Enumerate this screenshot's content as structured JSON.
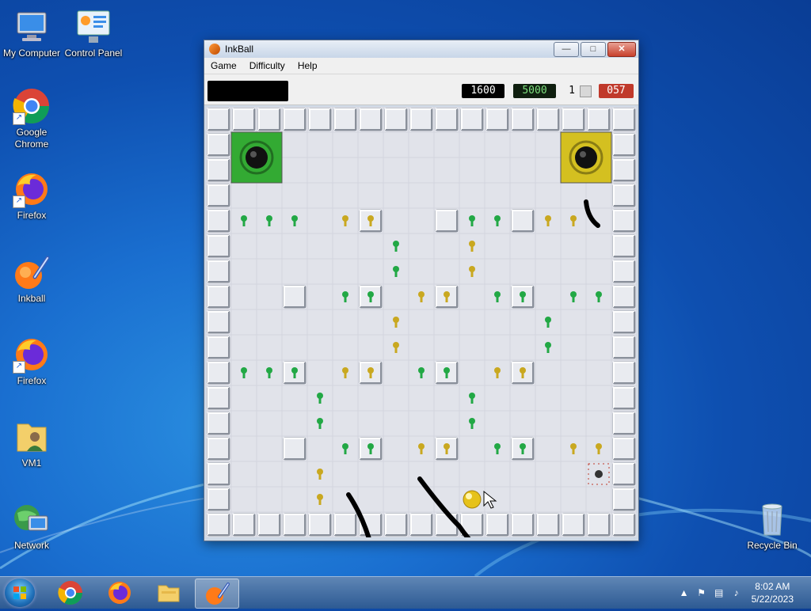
{
  "desktop": {
    "icons": [
      {
        "label": "My Computer",
        "icon": "computer-icon"
      },
      {
        "label": "Control Panel",
        "icon": "control-panel-icon"
      },
      {
        "label": "Google Chrome",
        "icon": "chrome-icon"
      },
      {
        "label": "Firefox",
        "icon": "firefox-icon"
      },
      {
        "label": "Inkball",
        "icon": "inkball-icon"
      },
      {
        "label": "Firefox",
        "icon": "firefox-icon"
      },
      {
        "label": "VM1",
        "icon": "user-folder-icon"
      },
      {
        "label": "Network",
        "icon": "network-icon"
      },
      {
        "label": "Recycle Bin",
        "icon": "recycle-bin-icon"
      }
    ]
  },
  "window": {
    "title": "InkBall",
    "controls": {
      "minimize": "—",
      "maximize": "□",
      "close": "✕"
    },
    "menu": [
      "Game",
      "Difficulty",
      "Help"
    ],
    "status": {
      "score": "1600",
      "target": "5000",
      "level": "1",
      "time": "057"
    }
  },
  "taskbar": {
    "apps": [
      "Google Chrome",
      "Firefox",
      "File Explorer",
      "InkBall"
    ],
    "clock_time": "8:02 AM",
    "clock_date": "5/22/2023"
  },
  "colors": {
    "green_goal": "#33aa33",
    "yellow_goal": "#d4c020",
    "green_pin": "#22a845",
    "yellow_pin": "#c9a820",
    "tile": "#e1e3ea",
    "ink": "#000000"
  },
  "game": {
    "grid_size": 17,
    "wall_rows": [
      "WWWWWWWWWWWWWWWWW",
      "W...............W",
      "W...............W",
      "W...............W",
      "W.....W..W..W...W",
      "W...............W",
      "W...............W",
      "W..W..W..W..W...W",
      "W...............W",
      "W...............W",
      "W..W..W..W..W...W",
      "W...............W",
      "W...............W",
      "W..W..W..W..W...W",
      "W...............W",
      "W...............W",
      "WWWWWWWWWWWWWWWWW"
    ],
    "pins": [
      [
        4,
        1,
        "g"
      ],
      [
        4,
        2,
        "g"
      ],
      [
        4,
        3,
        "g"
      ],
      [
        4,
        5,
        "y"
      ],
      [
        4,
        6,
        "y"
      ],
      [
        4,
        10,
        "g"
      ],
      [
        4,
        11,
        "g"
      ],
      [
        4,
        13,
        "y"
      ],
      [
        4,
        14,
        "y"
      ],
      [
        5,
        7,
        "g"
      ],
      [
        5,
        10,
        "y"
      ],
      [
        6,
        7,
        "g"
      ],
      [
        6,
        10,
        "y"
      ],
      [
        7,
        5,
        "g"
      ],
      [
        7,
        6,
        "g"
      ],
      [
        7,
        8,
        "y"
      ],
      [
        7,
        9,
        "y"
      ],
      [
        7,
        11,
        "g"
      ],
      [
        7,
        12,
        "g"
      ],
      [
        7,
        14,
        "g"
      ],
      [
        7,
        15,
        "g"
      ],
      [
        8,
        7,
        "y"
      ],
      [
        8,
        13,
        "g"
      ],
      [
        9,
        7,
        "y"
      ],
      [
        9,
        13,
        "g"
      ],
      [
        10,
        1,
        "g"
      ],
      [
        10,
        2,
        "g"
      ],
      [
        10,
        3,
        "g"
      ],
      [
        10,
        5,
        "y"
      ],
      [
        10,
        6,
        "y"
      ],
      [
        10,
        8,
        "g"
      ],
      [
        10,
        9,
        "g"
      ],
      [
        10,
        11,
        "y"
      ],
      [
        10,
        12,
        "y"
      ],
      [
        11,
        4,
        "g"
      ],
      [
        11,
        10,
        "g"
      ],
      [
        12,
        4,
        "g"
      ],
      [
        12,
        10,
        "g"
      ],
      [
        13,
        5,
        "g"
      ],
      [
        13,
        6,
        "g"
      ],
      [
        13,
        8,
        "y"
      ],
      [
        13,
        9,
        "y"
      ],
      [
        13,
        11,
        "g"
      ],
      [
        13,
        12,
        "g"
      ],
      [
        13,
        14,
        "y"
      ],
      [
        13,
        15,
        "y"
      ],
      [
        14,
        4,
        "y"
      ],
      [
        15,
        4,
        "y"
      ]
    ],
    "goals": [
      {
        "row": 1,
        "col": 1,
        "color": "green"
      },
      {
        "row": 1,
        "col": 14,
        "color": "yellow"
      }
    ],
    "ball": {
      "row": 15,
      "col": 10,
      "color": "yellow"
    },
    "spawner": {
      "row": 14,
      "col": 15
    }
  }
}
